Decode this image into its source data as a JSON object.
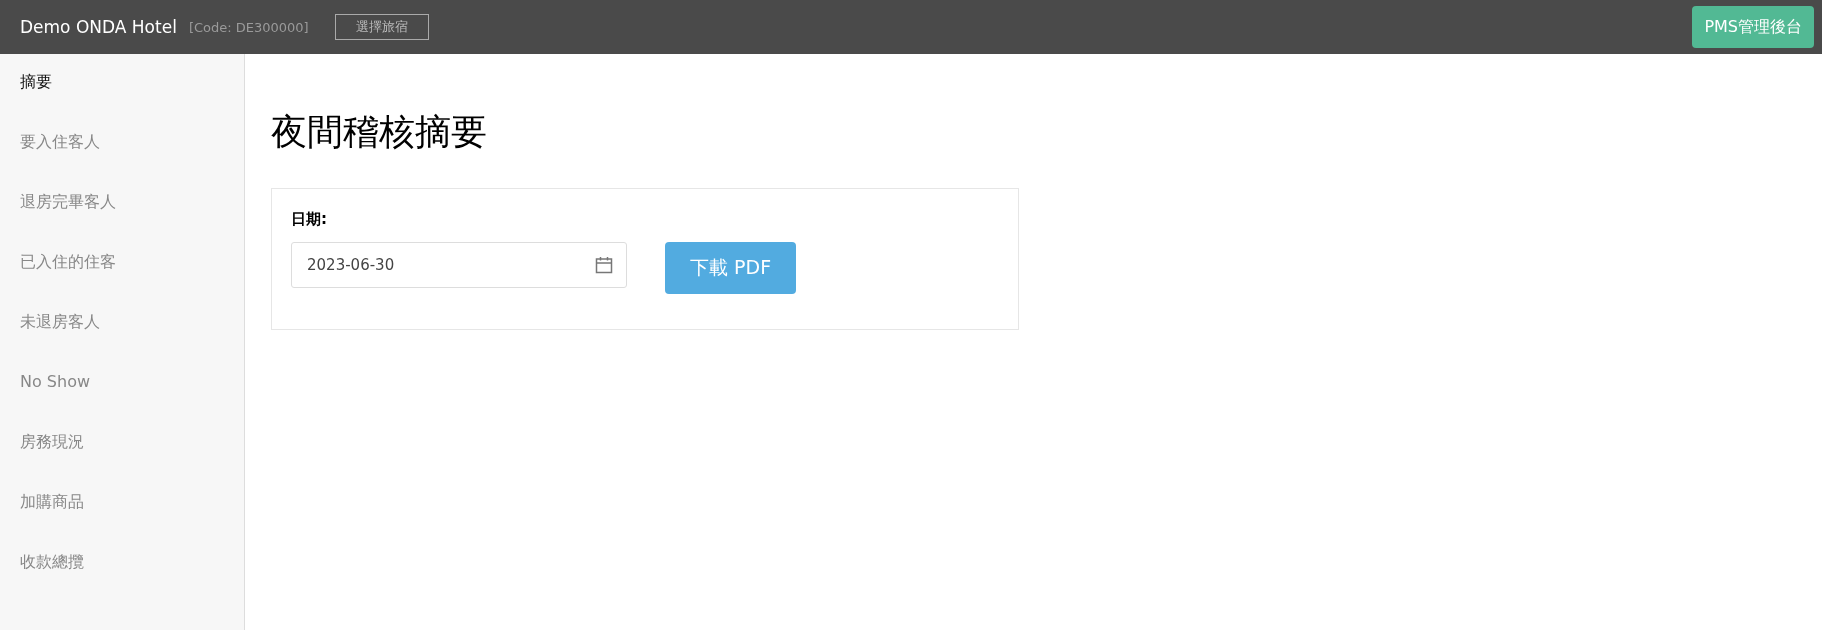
{
  "header": {
    "hotel_name": "Demo ONDA Hotel",
    "code": "[Code: DE300000]",
    "select_button": "選擇旅宿",
    "admin_button": "PMS管理後台"
  },
  "sidebar": {
    "items": [
      {
        "label": "摘要",
        "selected": true
      },
      {
        "label": "要入住客人",
        "selected": false
      },
      {
        "label": "退房完畢客人",
        "selected": false
      },
      {
        "label": "已入住的住客",
        "selected": false
      },
      {
        "label": "未退房客人",
        "selected": false
      },
      {
        "label": "No Show",
        "selected": false
      },
      {
        "label": "房務現況",
        "selected": false
      },
      {
        "label": "加購商品",
        "selected": false
      },
      {
        "label": "收款總攬",
        "selected": false
      }
    ]
  },
  "page_title": "夜間稽核摘要",
  "form": {
    "date_label": "日期:",
    "date_value": "2023-06-30",
    "download_button": "下載 PDF"
  }
}
